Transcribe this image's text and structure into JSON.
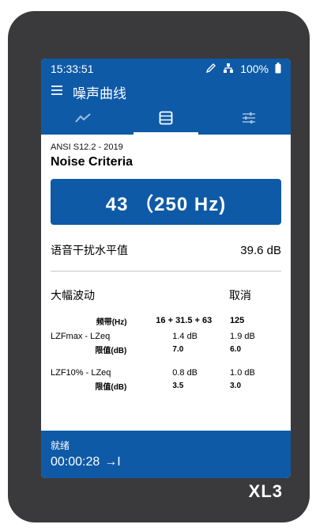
{
  "status": {
    "time": "15:33:51",
    "battery": "100%"
  },
  "appbar": {
    "title": "噪声曲线"
  },
  "tabs": [
    {
      "icon": "line-chart-icon"
    },
    {
      "icon": "table-icon",
      "active": true
    },
    {
      "icon": "sliders-icon"
    }
  ],
  "main": {
    "standard": "ANSI S12.2 - 2019",
    "title": "Noise Criteria",
    "result": "43 （250 Hz)",
    "sil_label": "语音干扰水平值",
    "sil_value": "39.6 dB",
    "fluct_label": "大幅波动",
    "cancel_label": "取消",
    "band_label": "频带(Hz)",
    "band_col1": "16 + 31.5 + 63",
    "band_col2": "125",
    "rows": [
      {
        "name": "LZFmax - LZeq",
        "v1": "1.4 dB",
        "v2": "1.9 dB",
        "limit_label": "限值(dB)",
        "l1": "7.0",
        "l2": "6.0"
      },
      {
        "name": "LZF10% - LZeq",
        "v1": "0.8 dB",
        "v2": "1.0 dB",
        "limit_label": "限值(dB)",
        "l1": "3.5",
        "l2": "3.0"
      }
    ]
  },
  "footer": {
    "status": "就绪",
    "timer": "00:00:28",
    "timer_icon": "→I"
  },
  "device": {
    "brand": "XL3"
  },
  "colors": {
    "accent": "#0e5aa7",
    "device": "#3a3a3c"
  }
}
